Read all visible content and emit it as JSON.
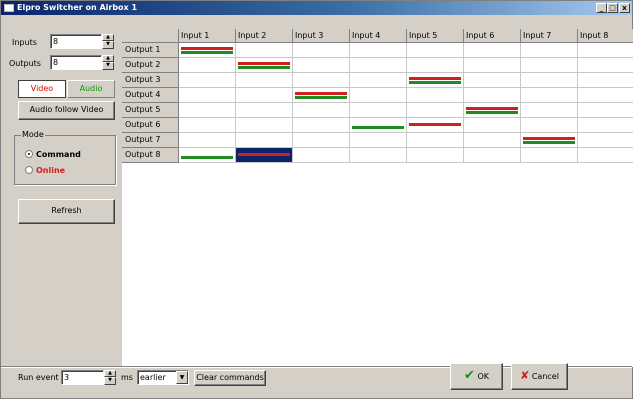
{
  "window": {
    "title": "Elpro Switcher on Airbox 1",
    "controls": {
      "minimize": "_",
      "maximize": "□",
      "close": "x"
    }
  },
  "sidebar": {
    "inputs_label": "Inputs",
    "inputs_value": "8",
    "outputs_label": "Outputs",
    "outputs_value": "8",
    "tab_video": "Video",
    "tab_audio": "Audio",
    "audio_follow_video": "Audio follow Video",
    "mode_legend": "Mode",
    "mode_command": "Command",
    "mode_online": "Online",
    "refresh": "Refresh"
  },
  "matrix": {
    "inputs": [
      "Input 1",
      "Input 2",
      "Input 3",
      "Input 4",
      "Input 5",
      "Input 6",
      "Input 7",
      "Input 8"
    ],
    "outputs": [
      "Output 1",
      "Output 2",
      "Output 3",
      "Output 4",
      "Output 5",
      "Output 6",
      "Output 7",
      "Output 8"
    ],
    "routes": [
      {
        "output": 1,
        "input": 1,
        "video": true,
        "audio": true
      },
      {
        "output": 2,
        "input": 2,
        "video": true,
        "audio": true
      },
      {
        "output": 3,
        "input": 5,
        "video": true,
        "audio": true
      },
      {
        "output": 4,
        "input": 3,
        "video": true,
        "audio": true
      },
      {
        "output": 5,
        "input": 6,
        "video": true,
        "audio": true
      },
      {
        "output": 6,
        "input": 5,
        "video": true,
        "audio": false
      },
      {
        "output": 6,
        "input": 4,
        "video": false,
        "audio": true
      },
      {
        "output": 7,
        "input": 7,
        "video": true,
        "audio": true
      },
      {
        "output": 8,
        "input": 2,
        "video": true,
        "audio": false
      },
      {
        "output": 8,
        "input": 1,
        "video": false,
        "audio": true
      }
    ],
    "selected_cell": {
      "output": 8,
      "input": 2
    },
    "colors": {
      "video": "#d21e1e",
      "audio": "#1e8c1e",
      "selected": "#0a246a"
    }
  },
  "footer": {
    "run_event_label": "Run event",
    "run_event_value": "3",
    "ms_label": "ms",
    "timing_value": "earlier",
    "clear_commands": "Clear commands",
    "ok": "OK",
    "cancel": "Cancel"
  },
  "icons": {
    "ok": "check-icon",
    "cancel": "x-icon"
  }
}
